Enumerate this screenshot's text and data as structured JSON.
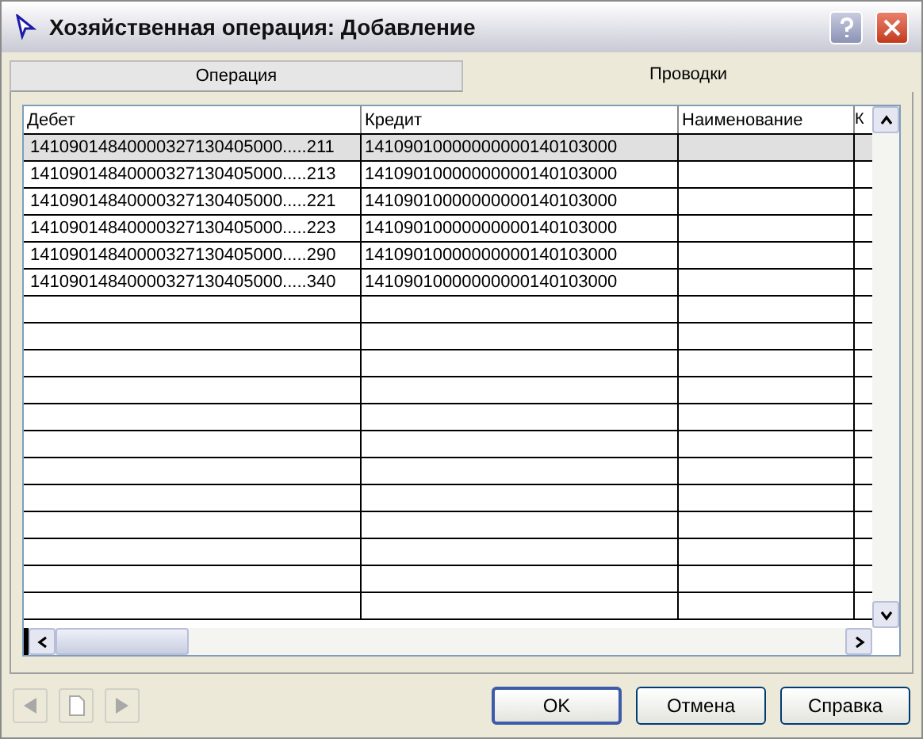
{
  "window": {
    "title": "Хозяйственная операция: Добавление"
  },
  "tabs": [
    {
      "label": "Операция",
      "selected": false
    },
    {
      "label": "Проводки",
      "selected": true
    }
  ],
  "table": {
    "columns": [
      "Дебет",
      "Кредит",
      "Наименование",
      "К"
    ],
    "rows": [
      {
        "debit": "14109014840000327130405000.....211",
        "credit": "14109010000000000140103000",
        "selected": true
      },
      {
        "debit": "14109014840000327130405000.....213",
        "credit": "14109010000000000140103000",
        "selected": false
      },
      {
        "debit": "14109014840000327130405000.....221",
        "credit": "14109010000000000140103000",
        "selected": false
      },
      {
        "debit": "14109014840000327130405000.....223",
        "credit": "14109010000000000140103000",
        "selected": false
      },
      {
        "debit": "14109014840000327130405000.....290",
        "credit": "14109010000000000140103000",
        "selected": false
      },
      {
        "debit": "14109014840000327130405000.....340",
        "credit": "14109010000000000140103000",
        "selected": false
      }
    ]
  },
  "buttons": [
    {
      "label": "OK",
      "default": true
    },
    {
      "label": "Отмена",
      "default": false
    },
    {
      "label": "Справка",
      "default": false
    }
  ]
}
